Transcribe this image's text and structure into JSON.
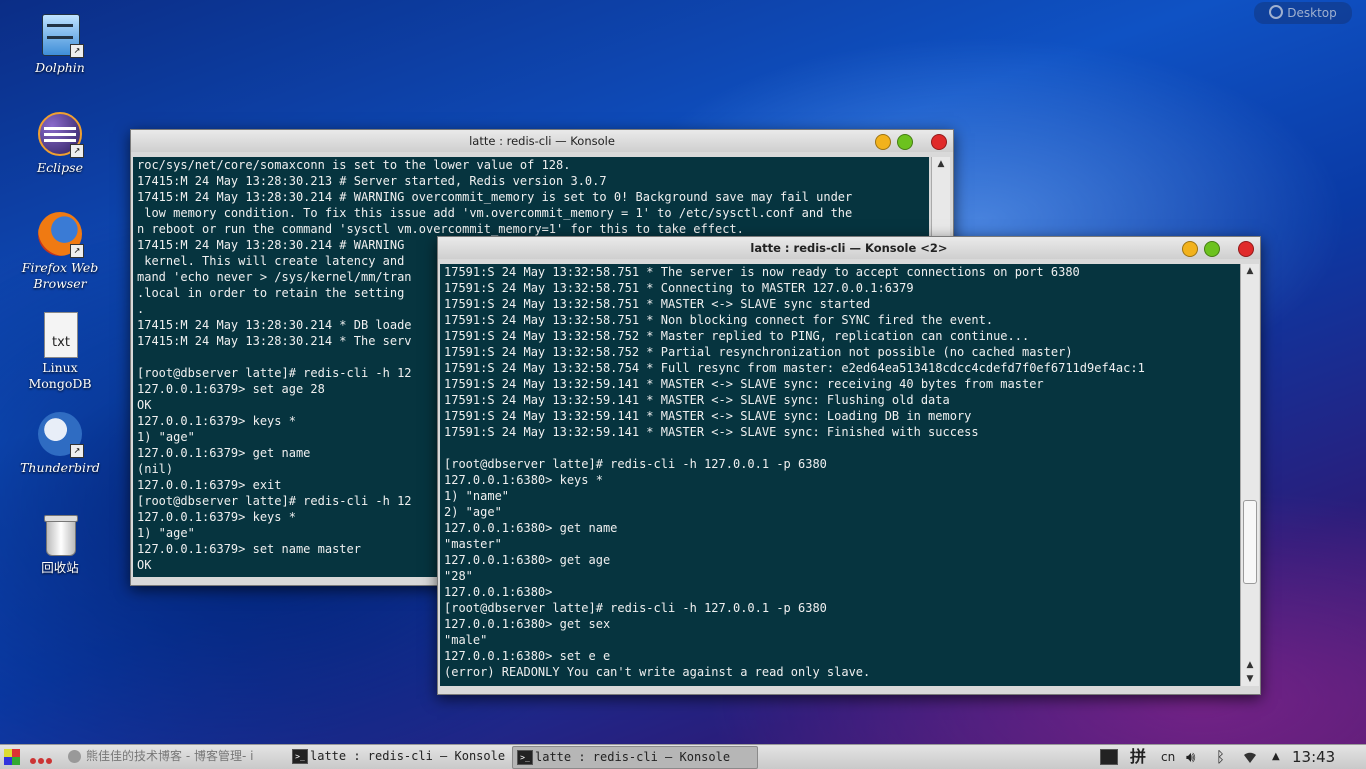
{
  "desktop": {
    "toggle_label": "Desktop",
    "icons": [
      {
        "label": "Dolphin"
      },
      {
        "label": "Eclipse"
      },
      {
        "label": "Firefox Web\nBrowser"
      },
      {
        "label": "Linux\nMongoDB"
      },
      {
        "label": "Thunderbird"
      },
      {
        "label": "回收站"
      }
    ]
  },
  "window1": {
    "title": "latte : redis-cli — Konsole",
    "lines": [
      "roc/sys/net/core/somaxconn is set to the lower value of 128.",
      "17415:M 24 May 13:28:30.213 # Server started, Redis version 3.0.7",
      "17415:M 24 May 13:28:30.214 # WARNING overcommit_memory is set to 0! Background save may fail under",
      " low memory condition. To fix this issue add 'vm.overcommit_memory = 1' to /etc/sysctl.conf and the",
      "n reboot or run the command 'sysctl vm.overcommit_memory=1' for this to take effect.",
      "17415:M 24 May 13:28:30.214 # WARNING",
      " kernel. This will create latency and",
      "mand 'echo never > /sys/kernel/mm/tran",
      ".local in order to retain the setting",
      ".",
      "17415:M 24 May 13:28:30.214 * DB loade",
      "17415:M 24 May 13:28:30.214 * The serv",
      "",
      "[root@dbserver latte]# redis-cli -h 12",
      "127.0.0.1:6379> set age 28",
      "OK",
      "127.0.0.1:6379> keys *",
      "1) \"age\"",
      "127.0.0.1:6379> get name",
      "(nil)",
      "127.0.0.1:6379> exit",
      "[root@dbserver latte]# redis-cli -h 12",
      "127.0.0.1:6379> keys *",
      "1) \"age\"",
      "127.0.0.1:6379> set name master",
      "OK"
    ]
  },
  "window2": {
    "title": "latte : redis-cli — Konsole <2>",
    "lines": [
      "17591:S 24 May 13:32:58.751 * The server is now ready to accept connections on port 6380",
      "17591:S 24 May 13:32:58.751 * Connecting to MASTER 127.0.0.1:6379",
      "17591:S 24 May 13:32:58.751 * MASTER <-> SLAVE sync started",
      "17591:S 24 May 13:32:58.751 * Non blocking connect for SYNC fired the event.",
      "17591:S 24 May 13:32:58.752 * Master replied to PING, replication can continue...",
      "17591:S 24 May 13:32:58.752 * Partial resynchronization not possible (no cached master)",
      "17591:S 24 May 13:32:58.754 * Full resync from master: e2ed64ea513418cdcc4cdefd7f0ef6711d9ef4ac:1",
      "17591:S 24 May 13:32:59.141 * MASTER <-> SLAVE sync: receiving 40 bytes from master",
      "17591:S 24 May 13:32:59.141 * MASTER <-> SLAVE sync: Flushing old data",
      "17591:S 24 May 13:32:59.141 * MASTER <-> SLAVE sync: Loading DB in memory",
      "17591:S 24 May 13:32:59.141 * MASTER <-> SLAVE sync: Finished with success",
      "",
      "[root@dbserver latte]# redis-cli -h 127.0.0.1 -p 6380",
      "127.0.0.1:6380> keys *",
      "1) \"name\"",
      "2) \"age\"",
      "127.0.0.1:6380> get name",
      "\"master\"",
      "127.0.0.1:6380> get age",
      "\"28\"",
      "127.0.0.1:6380>",
      "[root@dbserver latte]# redis-cli -h 127.0.0.1 -p 6380",
      "127.0.0.1:6380> get sex",
      "\"male\"",
      "127.0.0.1:6380> set e e",
      "(error) READONLY You can't write against a read only slave."
    ]
  },
  "taskbar": {
    "tasks": [
      {
        "label": "熊佳佳的技术博客 - 博客管理- i"
      },
      {
        "label": "latte : redis-cli — Konsole"
      },
      {
        "label": "latte : redis-cli — Konsole"
      }
    ],
    "input_method": "拼",
    "lang": "cn",
    "clock": "13:43"
  },
  "colors": {
    "terminal_bg": "#06343f",
    "terminal_fg": "#f0f0f0"
  },
  "icons": [
    "kde-menu-icon",
    "pager-dots-icon",
    "terminal-icon",
    "volume-icon",
    "bluetooth-icon",
    "wifi-icon",
    "tray-expand-icon"
  ]
}
